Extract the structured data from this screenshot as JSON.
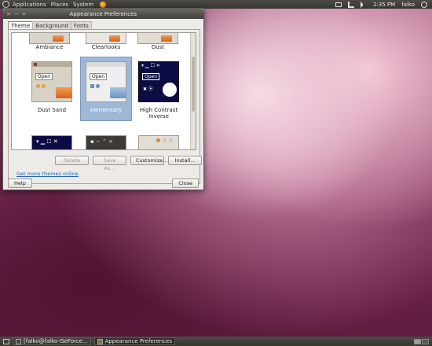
{
  "top_panel": {
    "menus": [
      "Applications",
      "Places",
      "System"
    ],
    "clock": "2:35 PM",
    "user": "falko"
  },
  "window": {
    "title": "Appearance Preferences",
    "tabs": [
      "Theme",
      "Background",
      "Fonts"
    ],
    "themes_top_row": [
      "Ambiance",
      "Clearlooks",
      "Dust"
    ],
    "themes_mid_row": [
      "Dust Sand",
      "elementary",
      "High Contrast Inverse"
    ],
    "selected_theme": "elementary",
    "preview_open_label": "Open",
    "actions": [
      "Delete",
      "Save As...",
      "Customize...",
      "Install..."
    ],
    "link": "Get more themes online",
    "help": "Help",
    "close": "Close"
  },
  "taskbar": {
    "tasks": [
      "[falko@falko-GeForce...",
      "Appearance Preferences"
    ]
  }
}
